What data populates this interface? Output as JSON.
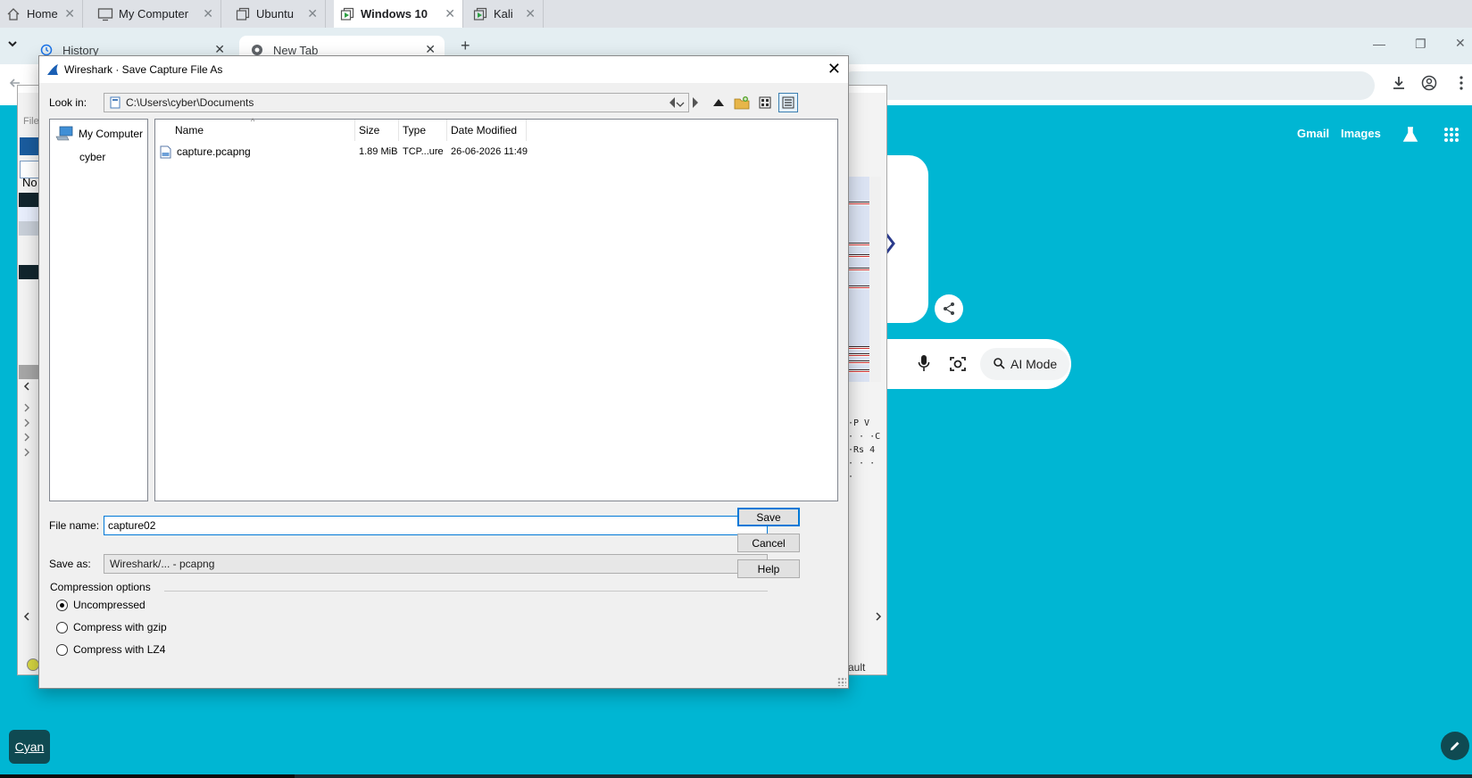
{
  "vm_tabs": [
    {
      "label": "Home",
      "icon": "home-icon"
    },
    {
      "label": "My Computer",
      "icon": "monitor-icon"
    },
    {
      "label": "Ubuntu",
      "icon": "vm-icon"
    },
    {
      "label": "Windows 10",
      "icon": "vm-running-icon",
      "active": true
    },
    {
      "label": "Kali",
      "icon": "vm-running-icon"
    }
  ],
  "chrome": {
    "tabs": [
      {
        "label": "History",
        "icon": "history-icon"
      },
      {
        "label": "New Tab",
        "icon": "chrome-icon",
        "active": true
      }
    ],
    "new_tab_symbol": "+",
    "links": {
      "gmail": "Gmail",
      "images": "Images"
    },
    "ai_mode_label": "AI Mode"
  },
  "taskbar": {
    "cyan_label": "Cyan"
  },
  "wireshark_bg": {
    "file_menu": "File",
    "column_no": "No",
    "status_text": "ault",
    "hex_rows": [
      "·P V",
      "· · ·C",
      "·Rs 4",
      "· · · ·"
    ]
  },
  "dialog": {
    "title": "Wireshark · Save Capture File As",
    "look_in_label": "Look in:",
    "look_in_path": "C:\\Users\\cyber\\Documents",
    "sidebar": [
      {
        "label": "My Computer",
        "icon": "computer-icon"
      },
      {
        "label": "cyber",
        "icon": ""
      }
    ],
    "columns": [
      "Name",
      "Size",
      "Type",
      "Date Modified"
    ],
    "files": [
      {
        "name": "capture.pcapng",
        "size": "1.89 MiB",
        "type": "TCP...ure",
        "modified": "26-06-2026 11:49"
      }
    ],
    "file_name_label": "File name:",
    "file_name_value": "capture02",
    "save_as_label": "Save as:",
    "save_as_value": "Wireshark/... - pcapng",
    "buttons": {
      "save": "Save",
      "cancel": "Cancel",
      "help": "Help"
    },
    "compression_label": "Compression options",
    "compression_options": [
      {
        "label": "Uncompressed",
        "selected": true
      },
      {
        "label": "Compress with gzip",
        "selected": false
      },
      {
        "label": "Compress with LZ4",
        "selected": false
      }
    ]
  }
}
